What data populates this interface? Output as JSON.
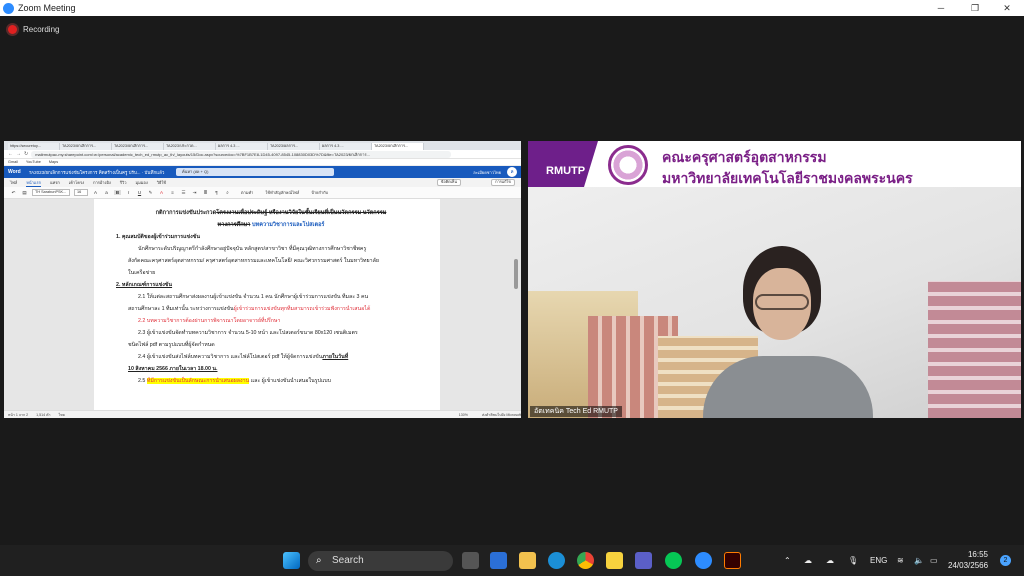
{
  "window": {
    "title": "Zoom Meeting",
    "controls": {
      "minimize": "─",
      "restore": "❐",
      "close": "✕"
    }
  },
  "recording": {
    "label": "Recording"
  },
  "shared_screen": {
    "browser_tabs": [
      "https://securetoy...",
      "TA2023/ยกเลิกการ...",
      "TA2023/ยกเลิกการ...",
      "TA2023/ประกวด...",
      "ผลการ 4.3 ...",
      "TA2023/ผลการ...",
      "ผลการ 4.3 ...",
      "TA2023/ยกเลิกการ..."
    ],
    "address_bar": "mailrmutpac-my.sharepoint.com/:w:/personal/academic_tech_ed_rmutp_ac_th/_layouts/15/Doc.aspx?sourcedoc=%7BF1B7E8-1D45-4097-8545-108830D03D%7D&file=TA2023/ยกเลิกการ...",
    "bookmarks": [
      "Gmail",
      "YouTube",
      "Maps"
    ],
    "word": {
      "app_label": "Word",
      "doc_title": "TA2023/ยกเลิกการแข่งขันโครงการ คิดสร้างเป็นครู ปรับ... · บันทึกแล้ว",
      "search_placeholder": "ค้นหา (Alt + Q)",
      "user_name": "ละเมียดชาวไทย",
      "user_initials": "ล",
      "ribbon_tabs": [
        "ไฟล์",
        "หน้าแรก",
        "แทรก",
        "เค้าโครง",
        "การอ้างอิง",
        "รีวิว",
        "มุมมอง",
        "วิธีใช้"
      ],
      "comments_button": "ข้อคิดเห็น",
      "editing_button": "การแก้ไข",
      "font_name": "TH SarabunPSK...",
      "font_size": "16",
      "ribbon_buttons": {
        "dictate": "ตามคำ",
        "designer": "ใช้ทำสัญลักษณ์ไฟล์",
        "sensitivity": "ป้ายกำกับ"
      }
    },
    "doc": {
      "title_line1_a": "กติกาการแข่งขันประกวด",
      "title_line1_b": "โครงงานเพื่อประดิษฐ์ หรืองานวิจัยในชั้นเรียนที่เป็นนวัตกรรม นวัตกรรม",
      "title_line2_a": "ทางการศึกษา",
      "title_line2_b": " บทความวิชาการและโปสเตอร์",
      "h1": "1. คุณสมบัติของผู้เข้าร่วมการแข่งขัน",
      "p1a": "นักศึกษาระดับปริญญาตรีกำลังศึกษาอยู่ปัจจุบัน หลักสูตร/สาขาวิชา ที่มีคุณวุฒิทางการศึกษาวิชาชีพครู",
      "p1b": "สังกัดคณะครุศาสตร์อุตสาหกรรม/ ครุศาสตร์อุตสาหกรรมและเทคโนโลยี/ คณะวิศวกรรมศาสตร์ ในมหาวิทยาลัย",
      "p1c": "ในเครือข่าย",
      "h2": "2. หลักเกณฑ์การแข่งขัน",
      "p21a": "2.1 ให้แต่ละสถานศึกษาส่งผลงานผู้เข้าแข่งขัน จำนวน 1 คน นักศึกษาผู้เข้าร่วมการแข่งขัน ทีมละ 3 คน",
      "p21b_a": "สถานศึกษาละ 1 ทีมเท่านั้น ระหว่างการแข่งขัน",
      "p21b_b": "ผู้เข้าร่วมการแข่งขันทุกทีมสามารถเข้าร่วมฟังการนำเสนอได้",
      "p22": "2.2 บทความวิชาการต้องผ่านการพิจารณาโดยอาจารย์ที่ปรึกษา",
      "p23a": "2.3 ผู้เข้าแข่งขันจัดทำบทความวิชาการ จำนวน 5-10 หน้า และโปสเตอร์ขนาด 80x120 เซนติเมตร",
      "p23b": "ชนิดไฟล์ pdf ตามรูปแบบที่ผู้จัดกำหนด",
      "p24a_a": "2.4 ผู้เข้าแข่งขันส่งไฟล์บทความวิชาการ และไฟล์โปสเตอร์ pdf ให้ผู้จัดการแข่งขัน",
      "p24a_b": "ภายในวันที่",
      "p24b": "10 สิงหาคม 2566 ภายในเวลา 18.00 น.",
      "p25_a": "2.5 ",
      "p25_b": "ทีมีการแข่งขันเป็นลักษณะการนำเสนอผลงาน",
      "p25_c": " และ ผู้เข้าแข่งขันนำเสนอในรูปแบบ"
    },
    "status": {
      "page": "หน้า 1 จาก 2",
      "words": "1,514 คำ",
      "lang": "ไทย",
      "zoom": "130%",
      "feedback": "ส่งคำติชมไปยัง Microsoft"
    }
  },
  "video": {
    "logo_text": "RMUTP",
    "faculty_line1": "คณะครุศาสตร์อุตสาหกรรม",
    "faculty_line2": "มหาวิทยาลัยเทคโนโลยีราชมงคลพระนคร",
    "participant_name": "อัตเทคนิค Tech Ed RMUTP"
  },
  "taskbar": {
    "search_label": "Search",
    "language": "ENG",
    "time": "16:55",
    "date": "24/03/2566",
    "notification_count": "2"
  }
}
